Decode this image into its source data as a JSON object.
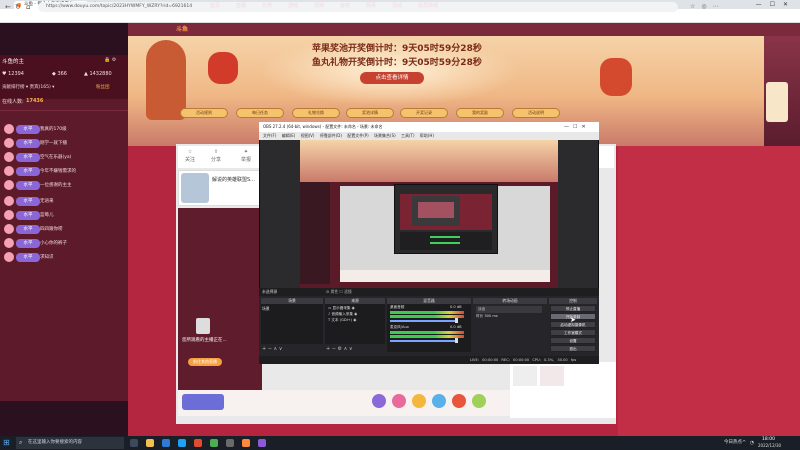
{
  "browser": {
    "tab_title": "斗鱼 - 每个人的直播平台",
    "url": "https://www.douyu.com/topic/2023HYWMFY_WZRY?rid=6921614",
    "colors": {
      "tabbar": "#dfe3e8",
      "accent": "#ff7a2a"
    }
  },
  "site": {
    "brand": "斗鱼",
    "nav": [
      "首页",
      "直播",
      "分类",
      "游戏",
      "视频",
      "鱼吧",
      "赛事",
      "活动",
      "会员商城"
    ]
  },
  "banner": {
    "countdown_1": "苹果奖池开奖倒计时：9天05时59分28秒",
    "countdown_2": "鱼丸礼物开奖倒计时：9天05时59分28秒",
    "detail_button": "点击查看详情",
    "buttons": [
      "活动规则",
      "每日任务",
      "礼物兑换",
      "奖池详情",
      "开奖记录",
      "我的奖励",
      "活动说明"
    ]
  },
  "chat": {
    "title": "斗鱼的主",
    "stats": {
      "a": "12394",
      "b": "366",
      "c": "1432880"
    },
    "tabs_left": "贡献排行榜 ▾    贵宾(165) ▾",
    "tabs_right": "粉丝团",
    "online_label": "在线人数:",
    "online_value": "17436",
    "badge": "水平",
    "messages": [
      "我真的170级",
      "刚学一就下播",
      "空气在乐器(ya)",
      "今年不嫌钱需求的",
      "一位感谢的主主",
      "无语来",
      "蓝莓儿",
      "四四跟你唠",
      "小心你的裤子",
      "求知识"
    ]
  },
  "stage": {
    "icons": [
      "关注",
      "分享",
      "举报"
    ],
    "anchor_name": "解说的英雄联盟S...",
    "offline_title": "您所观看的主播正在...",
    "offline_button": "前往其他直播"
  },
  "obs": {
    "title": "OBS 27.2.4 (64-bit, windows) - 配置文件: 未命名 - 场景: 未命名",
    "menu": "文件(F)  编辑(E)  视图(V)  停靠部件(D)  配置文件(P)  场景集合(S)  工具(T)  帮助(H)",
    "dock_label": "未选择源",
    "dock_mid": "⚙ 属性  ☐ 滤镜",
    "docks": {
      "scenes": "场景",
      "sources": "来源",
      "mixer": "混音器",
      "transitions": "转场动画",
      "controls": "控制"
    },
    "scene_item": "场景",
    "sources": [
      "显示器采集",
      "音频输入采集",
      "文本 (GDI+)"
    ],
    "mixer": [
      {
        "label": "桌面音频",
        "level": "0.0 dB"
      },
      {
        "label": "麦克风/Aux",
        "level": "0.0 dB"
      }
    ],
    "transition_type": "淡出",
    "transition_duration_label": "时长",
    "transition_duration": "300 ms",
    "controls": [
      "停止直播",
      "开始录制",
      "启动虚拟摄像机",
      "工作室模式",
      "设置",
      "退出"
    ],
    "status": "LIVE: 00:00:00  REC: 00:00:00  CPU: 0.3%, 30.00 fps"
  },
  "taskbar": {
    "search_placeholder": "在这里输入你要搜索的内容",
    "weather": "今日热点",
    "time": "18:00",
    "date": "2022/12/30"
  }
}
